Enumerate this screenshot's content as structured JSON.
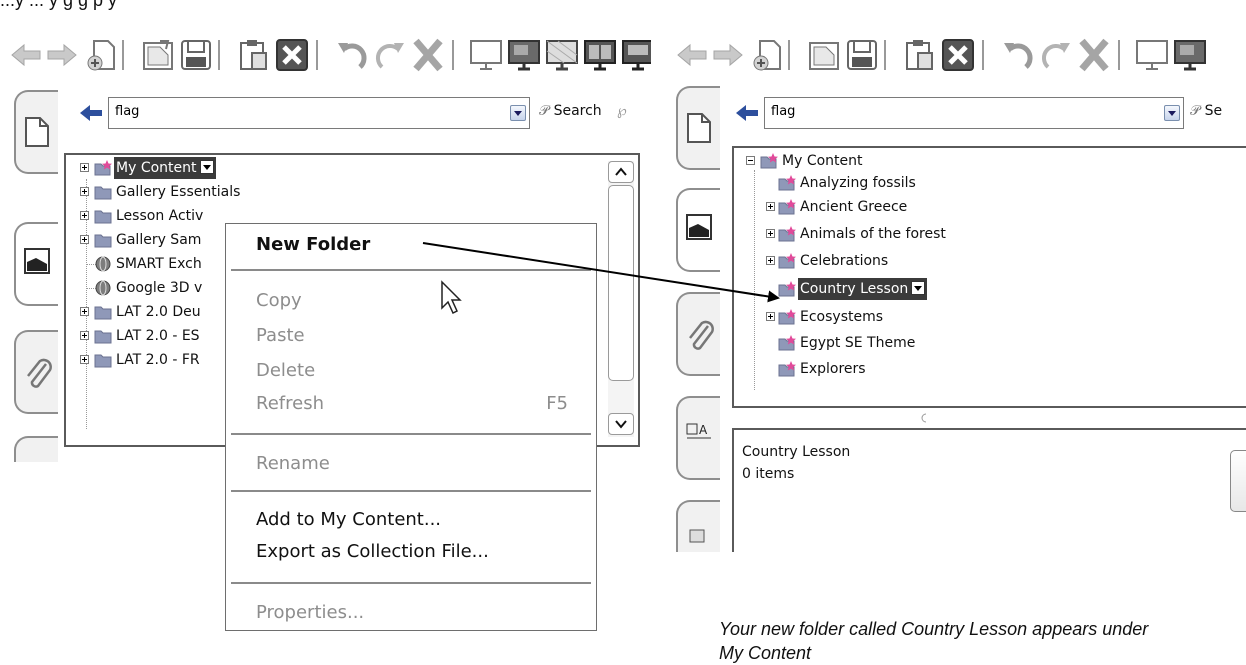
{
  "top_fragment": "...y    ... y     g g p y",
  "left_panel": {
    "search_value": "flag",
    "search_button": "Search",
    "tree": [
      {
        "label": "My Content",
        "selected": true
      },
      {
        "label": "Gallery Essentials"
      },
      {
        "label": "Lesson Activ"
      },
      {
        "label": "Gallery Sam"
      },
      {
        "label": "SMART Exch"
      },
      {
        "label": "Google 3D v"
      },
      {
        "label": "LAT 2.0 Deu"
      },
      {
        "label": "LAT 2.0 - ES"
      },
      {
        "label": "LAT 2.0 - FR"
      }
    ]
  },
  "context_menu": {
    "new_folder": "New Folder",
    "copy": "Copy",
    "paste": "Paste",
    "delete": "Delete",
    "refresh": "Refresh",
    "refresh_shortcut": "F5",
    "rename": "Rename",
    "add_to_my_content": "Add to My Content...",
    "export_collection": "Export as Collection File...",
    "properties": "Properties..."
  },
  "right_panel": {
    "search_value": "flag",
    "search_button": "Se",
    "tree_root": "My Content",
    "tree": [
      {
        "label": "Analyzing fossils"
      },
      {
        "label": "Ancient Greece"
      },
      {
        "label": "Animals of the forest"
      },
      {
        "label": "Celebrations"
      },
      {
        "label": "Country Lesson",
        "selected": true
      },
      {
        "label": "Ecosystems"
      },
      {
        "label": "Egypt SE Theme"
      },
      {
        "label": "Explorers"
      }
    ],
    "info_title": "Country Lesson",
    "info_count": "0 items"
  },
  "caption": {
    "line1": "Your new folder called Country Lesson appears under",
    "line2": "My Content"
  },
  "colors": {
    "selection": "#3b3b3b",
    "border": "#5a5a5a",
    "star": "#e14a9a",
    "folder": "#8f98b8",
    "arrow_blue": "#5b6dd9"
  }
}
